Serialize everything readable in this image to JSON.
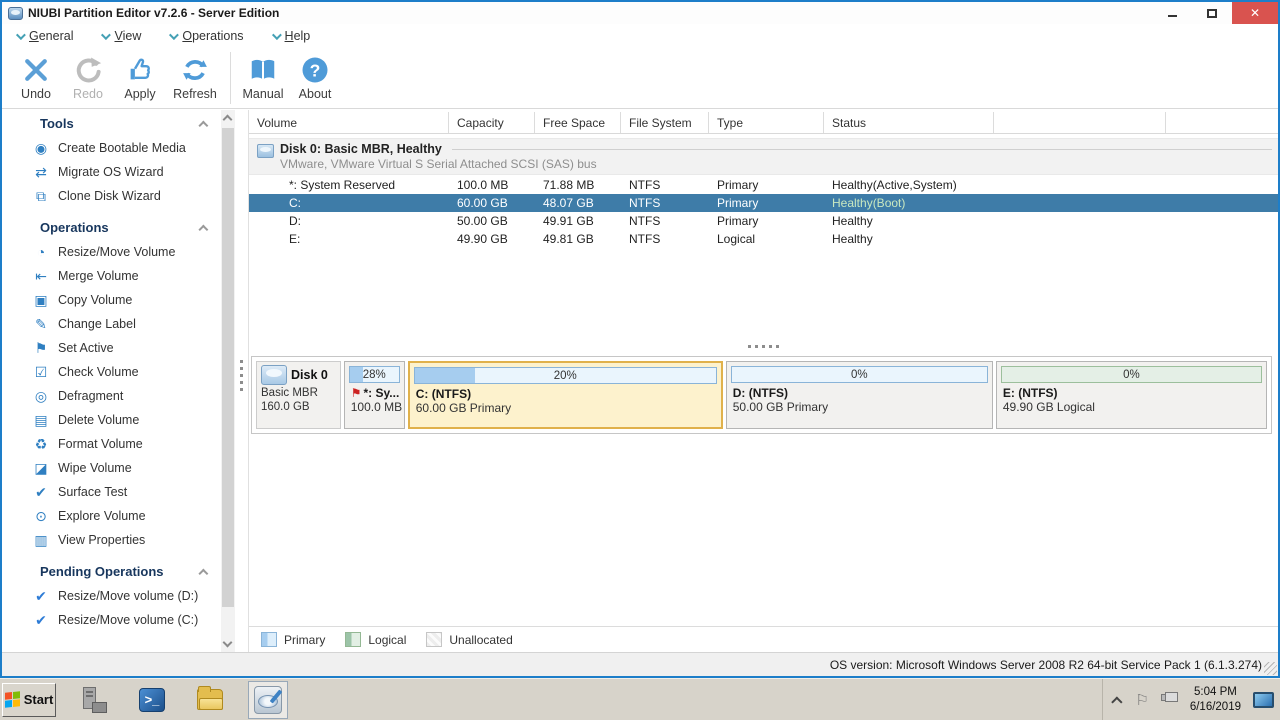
{
  "colors": {
    "window_border": "#1d7ec9",
    "selection_row_blue": "#3e7ca8",
    "selected_partition_border": "#e0b14b",
    "selected_partition_bg": "#fdf2cd",
    "primary_fill_blue": "#a6cdef",
    "logical_green": "#9cc4a8",
    "sidebar_icon_blue": "#2f7fc1",
    "close_button_red": "#d9534f",
    "menu_chevron_teal": "#45a1b5"
  },
  "titlebar": {
    "title": "NIUBI Partition Editor v7.2.6 - Server Edition",
    "close_glyph": "✕"
  },
  "menubar": {
    "items": [
      {
        "label": "General"
      },
      {
        "label": "View"
      },
      {
        "label": "Operations"
      },
      {
        "label": "Help"
      }
    ]
  },
  "toolbar": {
    "buttons": [
      {
        "label": "Undo",
        "enabled": true
      },
      {
        "label": "Redo",
        "enabled": false
      },
      {
        "label": "Apply",
        "enabled": true
      },
      {
        "label": "Refresh",
        "enabled": true
      }
    ],
    "help_buttons": [
      {
        "label": "Manual"
      },
      {
        "label": "About"
      }
    ]
  },
  "sidebar": {
    "sections": [
      {
        "title": "Tools",
        "items": [
          {
            "icon": "bootable-media-icon",
            "glyph": "◉",
            "label": "Create Bootable Media"
          },
          {
            "icon": "migrate-os-icon",
            "glyph": "⇄",
            "label": "Migrate OS Wizard"
          },
          {
            "icon": "clone-disk-icon",
            "glyph": "⧉",
            "label": "Clone Disk Wizard"
          }
        ]
      },
      {
        "title": "Operations",
        "items": [
          {
            "icon": "resize-move-icon",
            "glyph": "◔",
            "label": "Resize/Move Volume"
          },
          {
            "icon": "merge-volume-icon",
            "glyph": "⇤",
            "label": "Merge Volume"
          },
          {
            "icon": "copy-volume-icon",
            "glyph": "▣",
            "label": "Copy Volume"
          },
          {
            "icon": "change-label-icon",
            "glyph": "✎",
            "label": "Change Label"
          },
          {
            "icon": "set-active-icon",
            "glyph": "⚑",
            "label": "Set Active"
          },
          {
            "icon": "check-volume-icon",
            "glyph": "☑",
            "label": "Check Volume"
          },
          {
            "icon": "defragment-icon",
            "glyph": "◎",
            "label": "Defragment"
          },
          {
            "icon": "delete-volume-icon",
            "glyph": "▤",
            "label": "Delete Volume"
          },
          {
            "icon": "format-volume-icon",
            "glyph": "♻",
            "label": "Format Volume"
          },
          {
            "icon": "wipe-volume-icon",
            "glyph": "◪",
            "label": "Wipe Volume"
          },
          {
            "icon": "surface-test-icon",
            "glyph": "✔",
            "label": "Surface Test"
          },
          {
            "icon": "explore-volume-icon",
            "glyph": "⊙",
            "label": "Explore Volume"
          },
          {
            "icon": "view-properties-icon",
            "glyph": "▥",
            "label": "View Properties"
          }
        ]
      },
      {
        "title": "Pending Operations",
        "items": [
          {
            "icon": "pending-check-icon",
            "glyph": "✔",
            "label": "Resize/Move volume (D:)"
          },
          {
            "icon": "pending-check-icon",
            "glyph": "✔",
            "label": "Resize/Move volume (C:)"
          }
        ]
      }
    ]
  },
  "table": {
    "columns": [
      "Volume",
      "Capacity",
      "Free Space",
      "File System",
      "Type",
      "Status"
    ],
    "disk_group": {
      "title": "Disk 0: Basic MBR, Healthy",
      "subtitle": "VMware, VMware Virtual S Serial Attached SCSI (SAS) bus"
    },
    "rows": [
      {
        "volume": "*: System Reserved",
        "capacity": "100.0 MB",
        "free_space": "71.88 MB",
        "file_system": "NTFS",
        "type": "Primary",
        "status": "Healthy(Active,System)",
        "selected": false
      },
      {
        "volume": "C:",
        "capacity": "60.00 GB",
        "free_space": "48.07 GB",
        "file_system": "NTFS",
        "type": "Primary",
        "status": "Healthy(Boot)",
        "selected": true
      },
      {
        "volume": "D:",
        "capacity": "50.00 GB",
        "free_space": "49.91 GB",
        "file_system": "NTFS",
        "type": "Primary",
        "status": "Healthy",
        "selected": false
      },
      {
        "volume": "E:",
        "capacity": "49.90 GB",
        "free_space": "49.81 GB",
        "file_system": "NTFS",
        "type": "Logical",
        "status": "Healthy",
        "selected": false
      }
    ]
  },
  "diskmap": {
    "disk": {
      "name": "Disk 0",
      "layout": "Basic MBR",
      "size": "160.0 GB"
    },
    "partitions": [
      {
        "usage_label": "28%",
        "usage_pct": 28,
        "flag_glyph": "⚑",
        "label": "*: Sy...",
        "detail": "100.0 MB",
        "kind": "primary",
        "selected": false
      },
      {
        "usage_label": "20%",
        "usage_pct": 20,
        "label": "C: (NTFS)",
        "detail": "60.00 GB Primary",
        "kind": "primary",
        "selected": true
      },
      {
        "usage_label": "0%",
        "usage_pct": 0,
        "label": "D: (NTFS)",
        "detail": "50.00 GB Primary",
        "kind": "primary",
        "selected": false
      },
      {
        "usage_label": "0%",
        "usage_pct": 0,
        "label": "E: (NTFS)",
        "detail": "49.90 GB Logical",
        "kind": "logical",
        "selected": false
      }
    ]
  },
  "legend": {
    "items": [
      {
        "label": "Primary",
        "kind": "primary"
      },
      {
        "label": "Logical",
        "kind": "logical"
      },
      {
        "label": "Unallocated",
        "kind": "unallocated"
      }
    ]
  },
  "statusbar": {
    "text": "OS version: Microsoft Windows Server 2008 R2  64-bit Service Pack 1 (6.1.3.274)"
  },
  "taskbar": {
    "start_label": "Start",
    "tray": {
      "clock_time": "5:04 PM",
      "clock_date": "6/16/2019"
    }
  }
}
